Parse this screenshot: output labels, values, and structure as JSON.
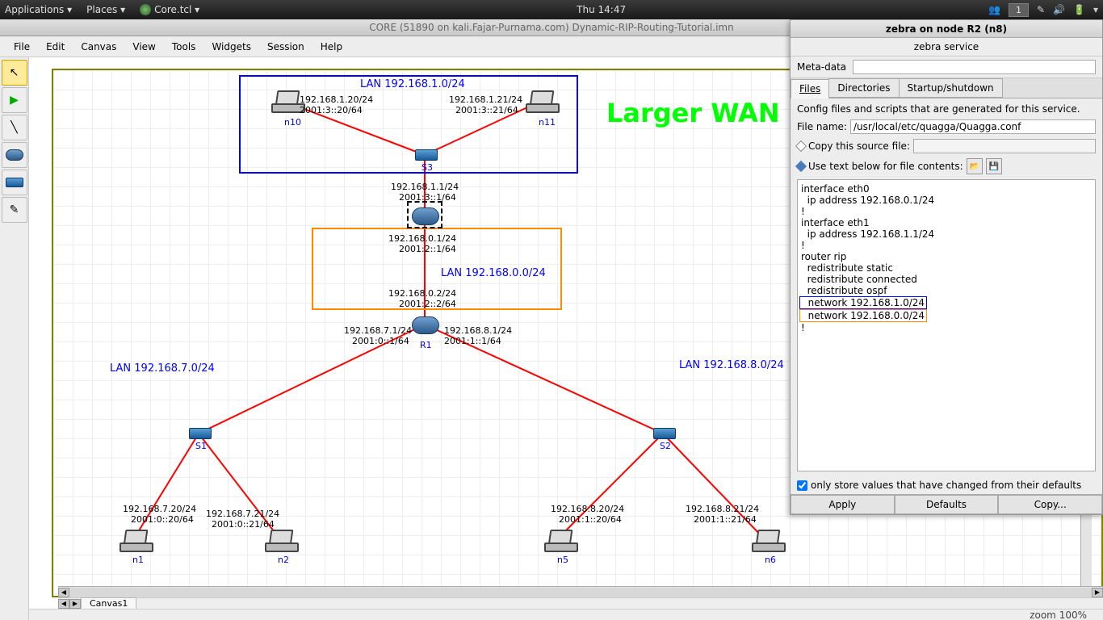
{
  "panel": {
    "apps": "Applications ▾",
    "places": "Places ▾",
    "coretcl": "Core.tcl ▾",
    "clock": "Thu 14:47",
    "workspace": "1"
  },
  "window": {
    "title": "CORE (51890 on kali.Fajar-Purnama.com) Dynamic-RIP-Routing-Tutorial.imn"
  },
  "menu": {
    "file": "File",
    "edit": "Edit",
    "canvas": "Canvas",
    "view": "View",
    "tools": "Tools",
    "widgets": "Widgets",
    "session": "Session",
    "help": "Help"
  },
  "canvas": {
    "wan_title": "Larger WAN",
    "lan1_title": "LAN 192.168.1.0/24",
    "lan0_title": "LAN 192.168.0.0/24",
    "lan7_title": "LAN 192.168.7.0/24",
    "lan8_title": "LAN 192.168.8.0/24",
    "n10_ip": "192.168.1.20/24",
    "n10_ip6": "2001:3::20/64",
    "n10_name": "n10",
    "n11_ip": "192.168.1.21/24",
    "n11_ip6": "2001:3::21/64",
    "n11_name": "n11",
    "s3_name": "S3",
    "r2_eth0": "192.168.1.1/24",
    "r2_eth0_6": "2001:3::1/64",
    "r2_eth1": "192.168.0.1/24",
    "r2_eth1_6": "2001:2::1/64",
    "r1_eth0": "192.168.0.2/24",
    "r1_eth0_6": "2001:2::2/64",
    "r1_eth1": "192.168.7.1/24",
    "r1_eth1_6": "2001:0::1/64",
    "r1_eth2": "192.168.8.1/24",
    "r1_eth2_6": "2001:1::1/64",
    "r1_name": "R1",
    "s1_name": "S1",
    "s2_name": "S2",
    "n1_ip": "192.168.7.20/24",
    "n1_ip6": "2001:0::20/64",
    "n1_name": "n1",
    "n2_ip": "192.168.7.21/24",
    "n2_ip6": "2001:0::21/64",
    "n2_name": "n2",
    "n5_ip": "192.168.8.20/24",
    "n5_ip6": "2001:1::20/64",
    "n5_name": "n5",
    "n6_ip": "192.168.8.21/24",
    "n6_ip6": "2001:1::21/64",
    "n6_name": "n6"
  },
  "tab": "Canvas1",
  "zoom": "zoom 100%",
  "side": {
    "title": "zebra on node R2 (n8)",
    "sub": "zebra service",
    "meta": "Meta-data",
    "tabs": {
      "files": "Files",
      "dirs": "Directories",
      "startup": "Startup/shutdown"
    },
    "desc": "Config files and scripts that are generated for this service.",
    "filename_label": "File name:",
    "filename": "/usr/local/etc/quagga/Quagga.conf",
    "copy_label": "Copy this source file:",
    "text_label": "Use text below for file contents:",
    "config": "interface eth0\n  ip address 192.168.0.1/24\n!\ninterface eth1\n  ip address 192.168.1.1/24\n!\nrouter rip\n  redistribute static\n  redistribute connected\n  redistribute ospf",
    "net1": "  network 192.168.1.0/24",
    "net0": "  network 192.168.0.0/24",
    "bang": "!",
    "check": "only store values that have changed from their defaults",
    "apply": "Apply",
    "defaults": "Defaults",
    "copy": "Copy..."
  }
}
